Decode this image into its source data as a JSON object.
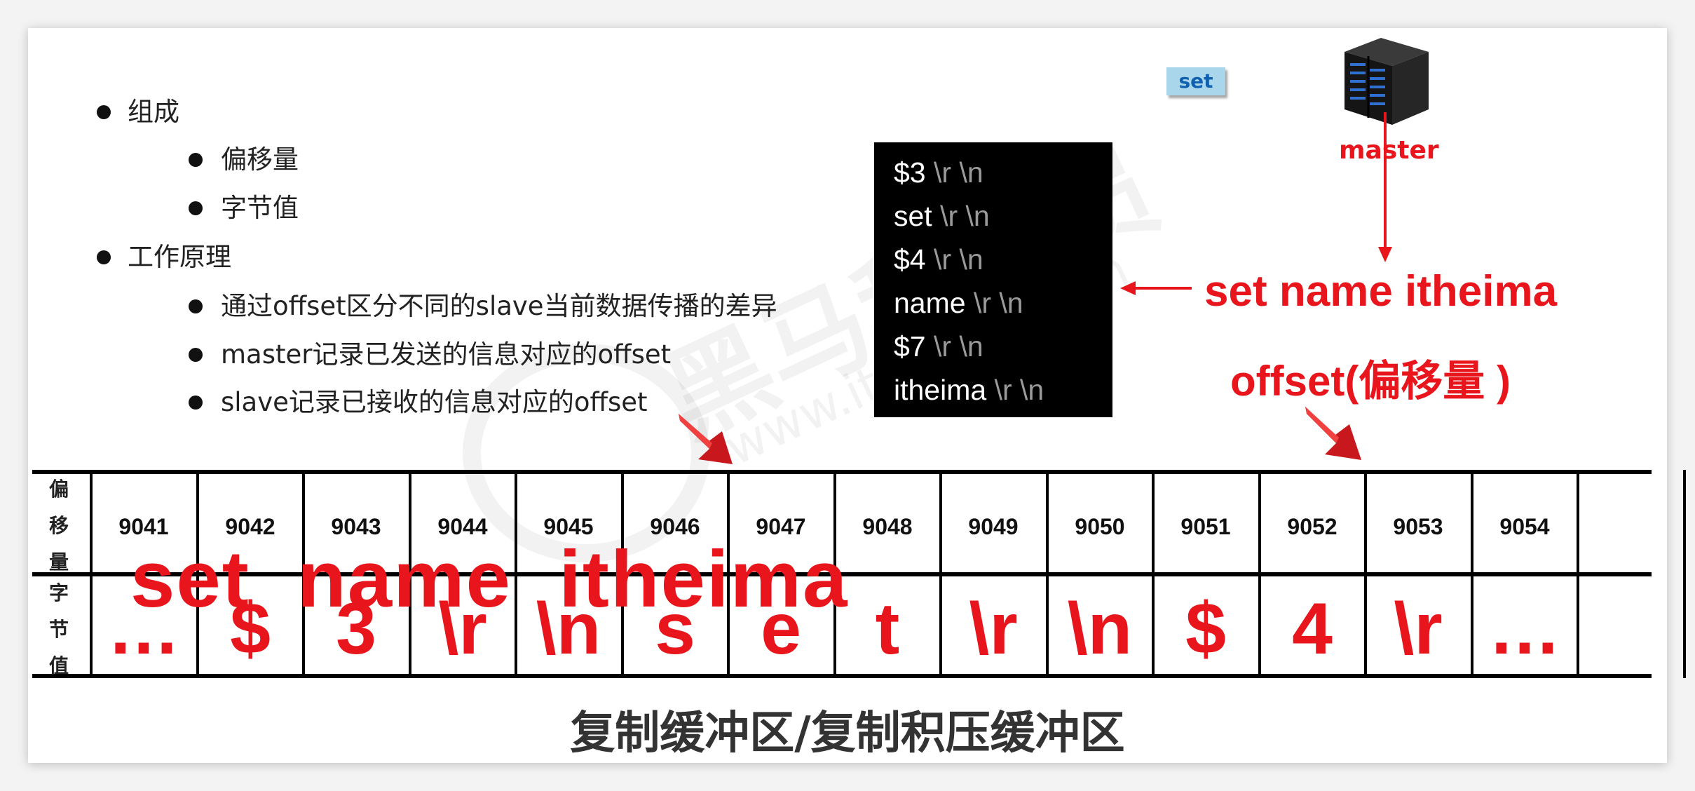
{
  "bullets": [
    {
      "level": 1,
      "text": "组成"
    },
    {
      "level": 2,
      "text": "偏移量"
    },
    {
      "level": 2,
      "text": "字节值"
    },
    {
      "level": 1,
      "text": "工作原理"
    },
    {
      "level": 2,
      "text": "通过offset区分不同的slave当前数据传播的差异"
    },
    {
      "level": 2,
      "text": "master记录已发送的信息对应的offset"
    },
    {
      "level": 2,
      "text": "slave记录已接收的信息对应的offset"
    }
  ],
  "command_box": {
    "lines": [
      {
        "token": "$3",
        "crlf": "\\r \\n"
      },
      {
        "token": "set",
        "crlf": "\\r \\n"
      },
      {
        "token": "$4",
        "crlf": "\\r \\n"
      },
      {
        "token": "name",
        "crlf": "\\r \\n"
      },
      {
        "token": "$7",
        "crlf": "\\r \\n"
      },
      {
        "token": "itheima",
        "crlf": "\\r \\n"
      }
    ]
  },
  "set_label": "set",
  "server": {
    "label": "master",
    "icon": "server-icon"
  },
  "command_label": "set name itheima",
  "offset_label": "offset(偏移量 )",
  "overlay_label": "set  name  itheima",
  "table": {
    "offset_row_label": [
      "偏",
      "移",
      "量"
    ],
    "byte_row_label": [
      "字",
      "节",
      "值"
    ],
    "offsets": [
      "9041",
      "9042",
      "9043",
      "9044",
      "9045",
      "9046",
      "9047",
      "9048",
      "9049",
      "9050",
      "9051",
      "9052",
      "9053",
      "9054",
      ""
    ],
    "bytes": [
      "…",
      "$",
      "3",
      "\\r",
      "\\n",
      "s",
      "e",
      "t",
      "\\r",
      "\\n",
      "$",
      "4",
      "\\r",
      "…",
      ""
    ]
  },
  "caption": "复制缓冲区/复制积压缓冲区",
  "colors": {
    "accent_red": "#e8151c",
    "terminal_bg": "#000000",
    "crlf_gray": "#9a9a9a",
    "set_label_bg": "#a9d6ea"
  }
}
